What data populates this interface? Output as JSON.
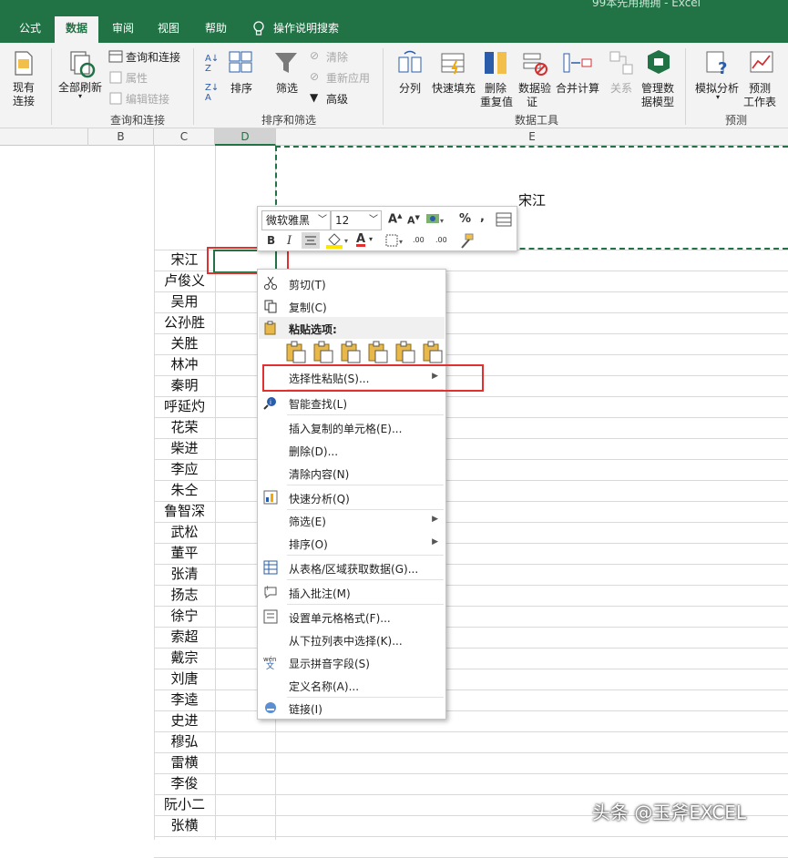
{
  "title": "99本先用拥拥 - Excel",
  "tabs": [
    {
      "label": "公式",
      "active": false
    },
    {
      "label": "数据",
      "active": true
    },
    {
      "label": "审阅",
      "active": false
    },
    {
      "label": "视图",
      "active": false
    },
    {
      "label": "帮助",
      "active": false
    }
  ],
  "tell_me": "操作说明搜索",
  "ribbon": {
    "existing_connections": [
      "现有",
      "连接"
    ],
    "refresh_all": "全部刷新",
    "queries_connections": "查询和连接",
    "properties": "属性",
    "edit_links": "编辑链接",
    "group_queries": "查询和连接",
    "sort": "排序",
    "filter": "筛选",
    "clear": "清除",
    "reapply": "重新应用",
    "advanced": "高级",
    "group_sort_filter": "排序和筛选",
    "text_to_columns": "分列",
    "flash_fill": "快速填充",
    "remove_duplicates": [
      "删除",
      "重复值"
    ],
    "data_validation": [
      "数据验",
      "证"
    ],
    "consolidate": "合并计算",
    "relationships": "关系",
    "manage_data_model": [
      "管理数",
      "据模型"
    ],
    "group_data_tools": "数据工具",
    "what_if": "模拟分析",
    "forecast_sheet": [
      "预测",
      "工作表"
    ],
    "group_forecast": "预测"
  },
  "columns": [
    "B",
    "C",
    "D",
    "E"
  ],
  "merged_cell_text": "宋江",
  "names": [
    "宋江",
    "卢俊义",
    "吴用",
    "公孙胜",
    "关胜",
    "林冲",
    "秦明",
    "呼延灼",
    "花荣",
    "柴进",
    "李应",
    "朱仝",
    "鲁智深",
    "武松",
    "董平",
    "张清",
    "扬志",
    "徐宁",
    "索超",
    "戴宗",
    "刘唐",
    "李逵",
    "史进",
    "穆弘",
    "雷横",
    "李俊",
    "阮小二",
    "张横"
  ],
  "mini_toolbar": {
    "font": "微软雅黑",
    "size": "12",
    "percent": "%",
    "comma": ",",
    "bold": "B",
    "italic": "I",
    "font_color_letter": "A",
    "inc_decimal": ".00",
    "dec_decimal": ".00"
  },
  "menu": {
    "cut": "剪切(T)",
    "copy": "复制(C)",
    "paste_options": "粘贴选项:",
    "paste_special": "选择性粘贴(S)...",
    "smart_lookup": "智能查找(L)",
    "insert_copied": "插入复制的单元格(E)...",
    "delete": "删除(D)...",
    "clear_contents": "清除内容(N)",
    "quick_analysis": "快速分析(Q)",
    "filter": "筛选(E)",
    "sort": "排序(O)",
    "from_table": "从表格/区域获取数据(G)...",
    "insert_comment": "插入批注(M)",
    "format_cells": "设置单元格格式(F)...",
    "pick_from_list": "从下拉列表中选择(K)...",
    "phonetic": "显示拼音字段(S)",
    "define_name": "定义名称(A)...",
    "link": "链接(I)"
  },
  "watermark": "头条 @玉斧EXCEL",
  "colors": {
    "excel_green": "#217346",
    "highlight_red": "#e03030"
  }
}
